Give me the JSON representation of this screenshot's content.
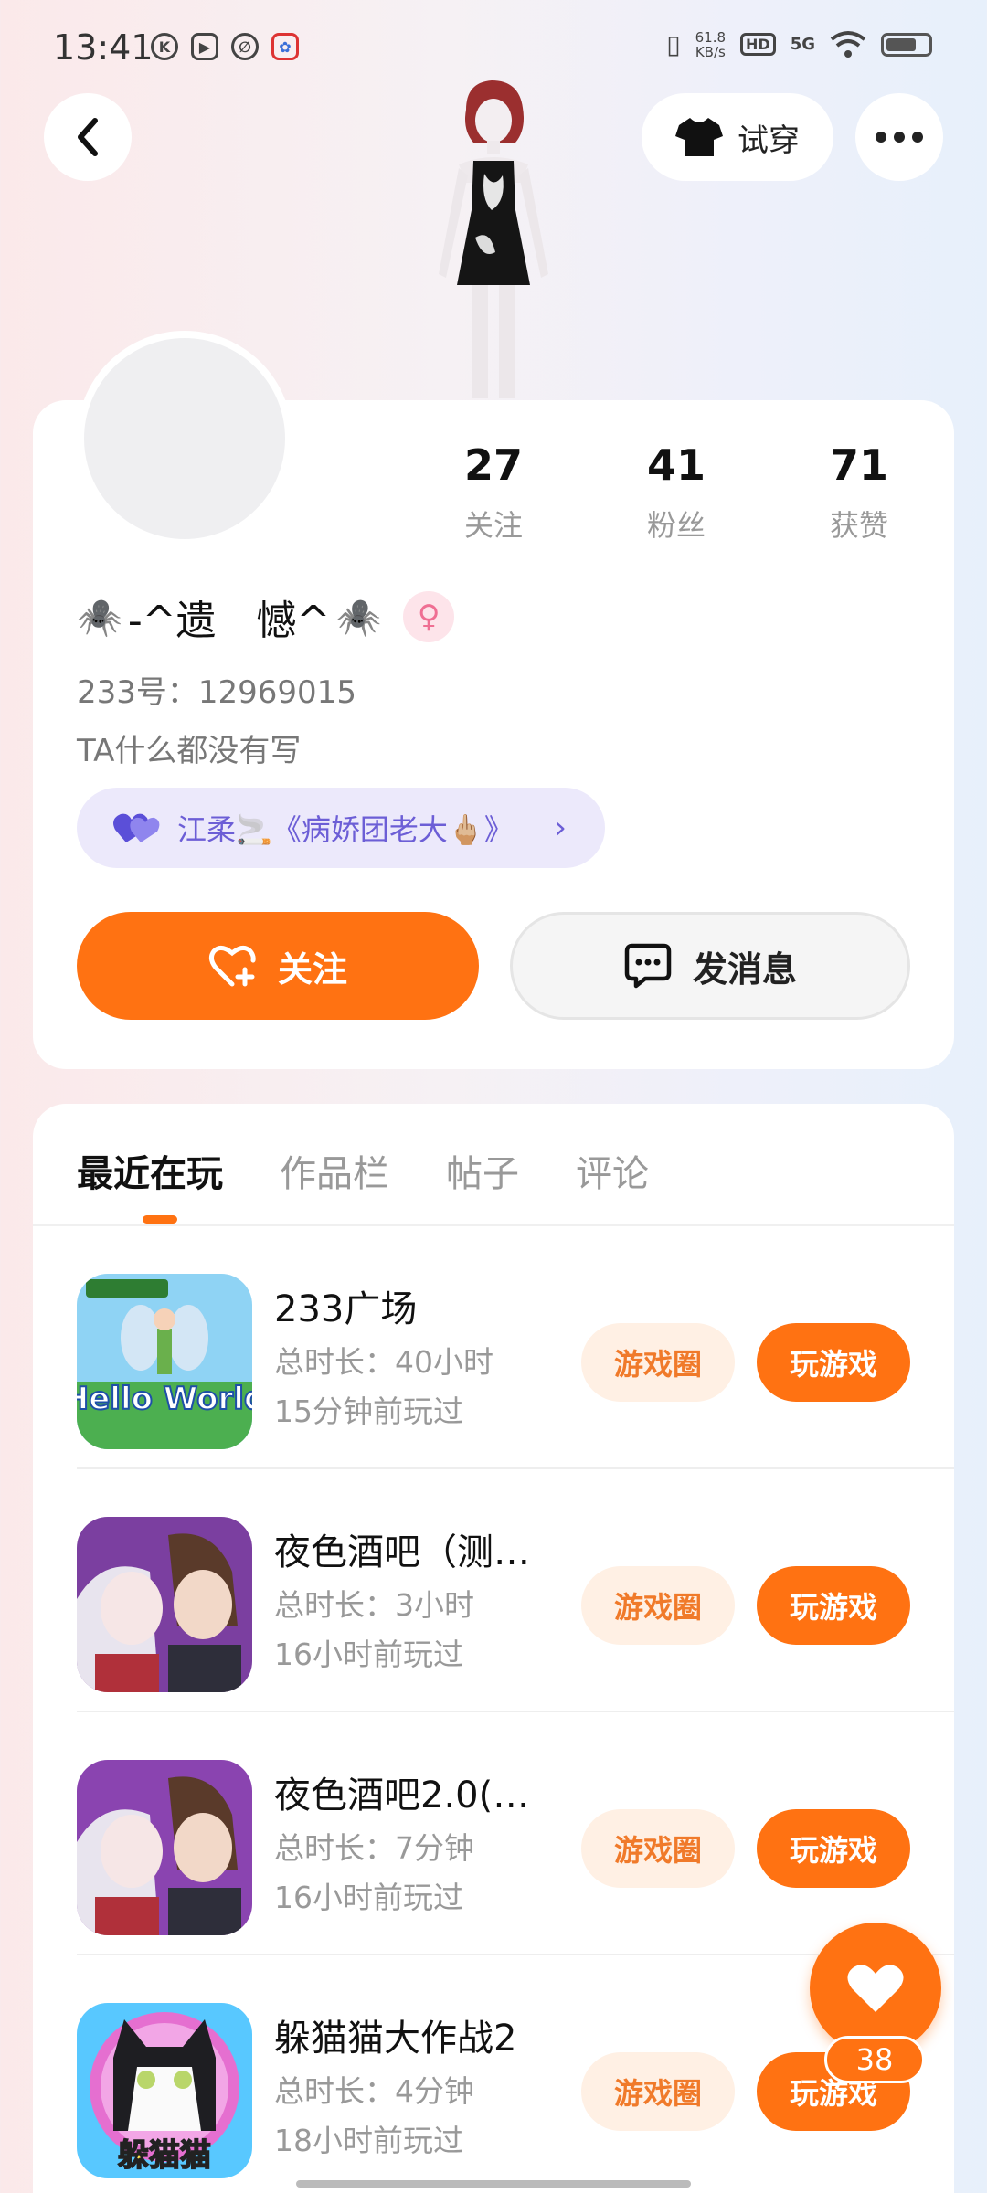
{
  "status_bar": {
    "time": "13:41",
    "net_speed_value": "61.8",
    "net_speed_unit": "KB/s",
    "hd": "HD",
    "network": "5G",
    "battery_percent": 75,
    "app_icons": [
      "k-icon",
      "play-icon",
      "leaf-icon",
      "baidu-icon"
    ]
  },
  "header": {
    "try_on_label": "试穿"
  },
  "profile": {
    "stats": [
      {
        "value": "27",
        "label": "关注"
      },
      {
        "value": "41",
        "label": "粉丝"
      },
      {
        "value": "71",
        "label": "获赞"
      }
    ],
    "username_prefix": "🕷️",
    "username": "-^遗　憾^",
    "username_suffix": "🕷️",
    "gender_symbol": "♀",
    "uid": "233号：12969015",
    "bio": "TA什么都没有写",
    "relation_text": "江柔🚬《病娇团老大🖕🏼》",
    "follow_label": "关注",
    "message_label": "发消息"
  },
  "tabs": [
    {
      "label": "最近在玩",
      "active": true
    },
    {
      "label": "作品栏",
      "active": false
    },
    {
      "label": "帖子",
      "active": false
    },
    {
      "label": "评论",
      "active": false
    }
  ],
  "games": [
    {
      "name": "233广场",
      "duration": "总时长：40小时",
      "last_played": "15分钟前玩过",
      "circle_label": "游戏圈",
      "play_label": "玩游戏",
      "icon_text": "Hello World"
    },
    {
      "name": "夜色酒吧（测…",
      "duration": "总时长：3小时",
      "last_played": "16小时前玩过",
      "circle_label": "游戏圈",
      "play_label": "玩游戏",
      "icon_text": ""
    },
    {
      "name": "夜色酒吧2.0(…",
      "duration": "总时长：7分钟",
      "last_played": "16小时前玩过",
      "circle_label": "游戏圈",
      "play_label": "玩游戏",
      "icon_text": ""
    },
    {
      "name": "躲猫猫大作战2",
      "duration": "总时长：4分钟",
      "last_played": "18小时前玩过",
      "circle_label": "游戏圈",
      "play_label": "玩游戏",
      "icon_text": "躲猫猫"
    }
  ],
  "like_count": "38",
  "colors": {
    "accent": "#ff7212",
    "chip_bg": "#fff0e4",
    "relation_bg": "#ece9fb",
    "relation_text": "#6c5ed6"
  }
}
